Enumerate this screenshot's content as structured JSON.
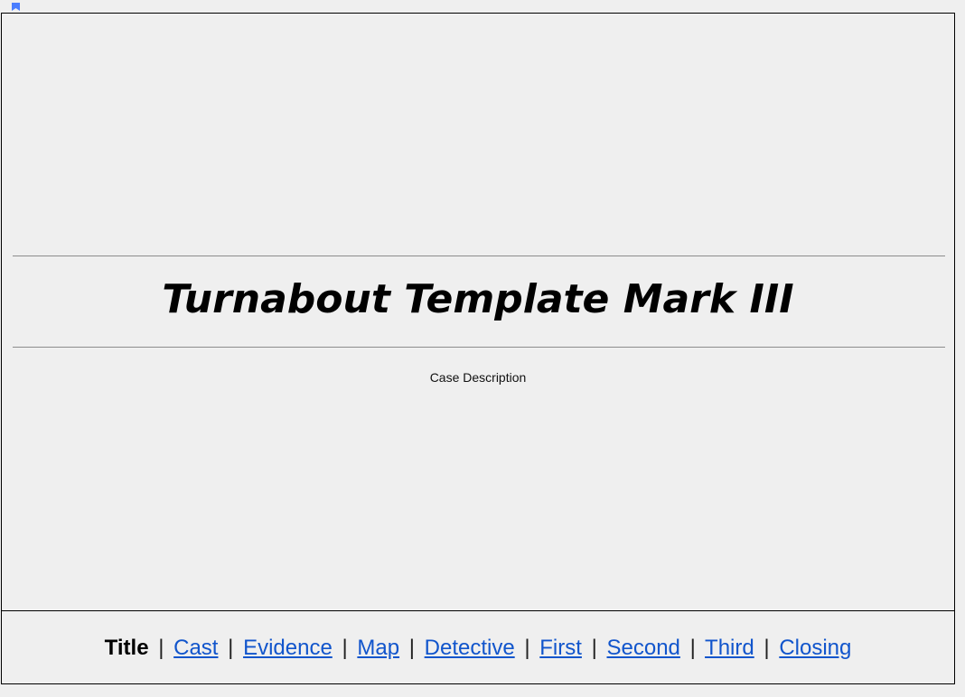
{
  "document": {
    "title": "Turnabout Template Mark III",
    "description": "Case Description"
  },
  "nav": {
    "current": "Title",
    "links": [
      "Cast",
      "Evidence",
      "Map",
      "Detective",
      "First",
      "Second",
      "Third",
      "Closing"
    ],
    "separator": "|",
    "link_color": "#1155cc"
  },
  "bookmark": {
    "icon": "bookmark-icon",
    "color": "#4a7dff"
  }
}
